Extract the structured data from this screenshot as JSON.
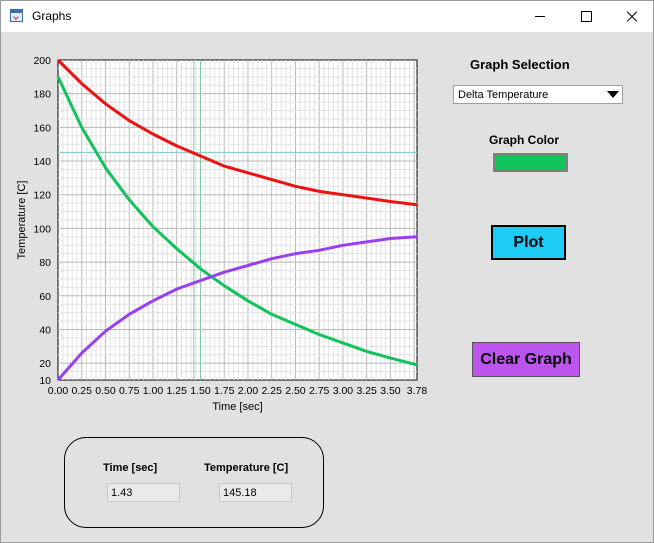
{
  "window": {
    "title": "Graphs",
    "icon": "app-graph-icon"
  },
  "controls": {
    "graph_selection_label": "Graph Selection",
    "graph_selection_value": "Delta Temperature",
    "graph_color_label": "Graph Color",
    "graph_color": "#10c35a",
    "plot_label": "Plot",
    "plot_color": "#1ecbf5",
    "clear_label": "Clear Graph",
    "clear_color": "#bb55ee"
  },
  "readout": {
    "time_label": "Time [sec]",
    "temperature_label": "Temperature [C]",
    "time_value": "1.43",
    "temperature_value": "145.18"
  },
  "chart_data": {
    "type": "line",
    "title": "",
    "xlabel": "Time [sec]",
    "ylabel": "Temperature [C]",
    "xlim": [
      0,
      3.78
    ],
    "ylim": [
      10,
      200
    ],
    "x_ticks": [
      "0.00",
      "0.25",
      "0.50",
      "0.75",
      "1.00",
      "1.25",
      "1.50",
      "1.75",
      "2.00",
      "2.25",
      "2.50",
      "2.75",
      "3.00",
      "3.25",
      "3.50",
      "3.78"
    ],
    "y_ticks": [
      "200",
      "180",
      "160",
      "140",
      "120",
      "100",
      "80",
      "60",
      "40",
      "20",
      "10"
    ],
    "grid": true,
    "cursor": {
      "x": 1.43,
      "y": 145.18,
      "x2": 1.5
    },
    "x": [
      0,
      0.25,
      0.5,
      0.75,
      1.0,
      1.25,
      1.5,
      1.75,
      2.0,
      2.25,
      2.5,
      2.75,
      3.0,
      3.25,
      3.5,
      3.78
    ],
    "series": [
      {
        "color": "#ee1111",
        "values": [
          200,
          186,
          174,
          164,
          156,
          149,
          143,
          137,
          133,
          129,
          125,
          122,
          120,
          118,
          116,
          114
        ]
      },
      {
        "color": "#10c35a",
        "values": [
          190,
          160,
          136,
          117,
          101,
          88,
          76,
          66,
          57,
          49,
          43,
          37,
          32,
          27,
          23,
          19
        ]
      },
      {
        "color": "#9a3ff0",
        "values": [
          10,
          26,
          39,
          49,
          57,
          64,
          69,
          74,
          78,
          82,
          85,
          87,
          90,
          92,
          94,
          95
        ]
      }
    ]
  }
}
